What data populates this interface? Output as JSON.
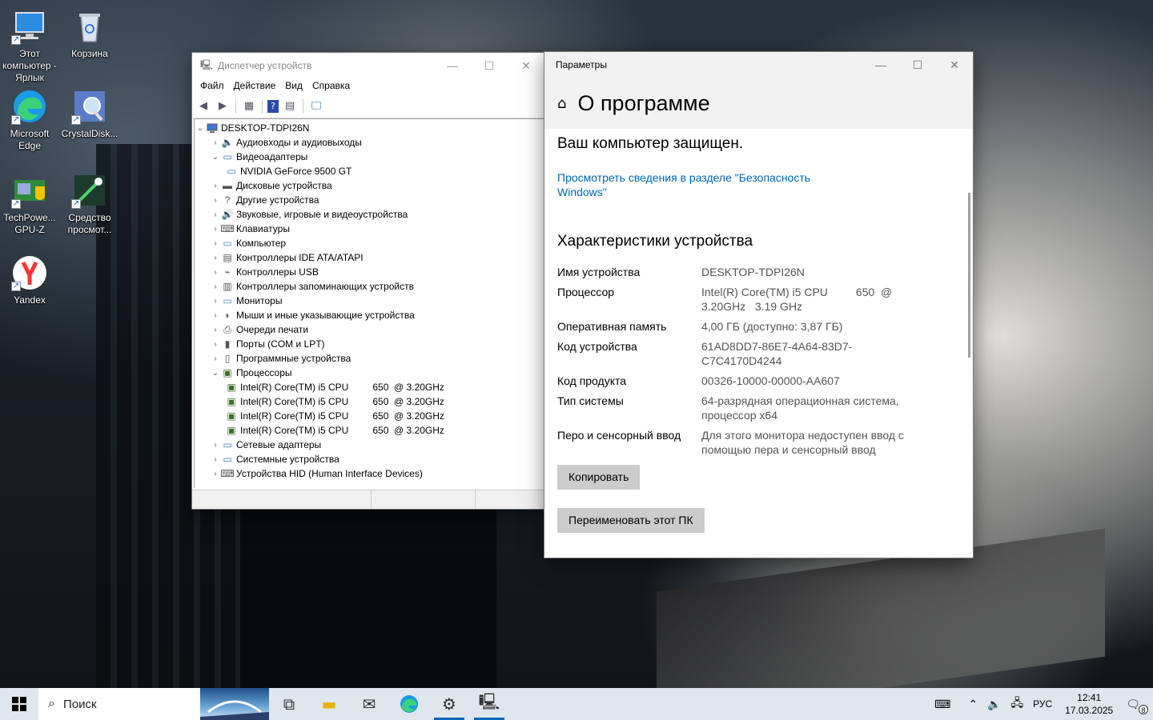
{
  "desktop": {
    "icons": [
      {
        "label": "Этот компьютер - Ярлык",
        "icon": "computer-icon"
      },
      {
        "label": "Корзина",
        "icon": "recycle-bin-icon"
      },
      {
        "label": "Microsoft Edge",
        "icon": "edge-icon"
      },
      {
        "label": "CrystalDisk...",
        "icon": "crystaldisk-icon"
      },
      {
        "label": "TechPowe... GPU-Z",
        "icon": "gpu-z-icon"
      },
      {
        "label": "Средство просмот...",
        "icon": "viewer-tool-icon"
      },
      {
        "label": "Yandex",
        "icon": "yandex-icon"
      }
    ]
  },
  "device_manager": {
    "title": "Диспетчер устройств",
    "menu": [
      "Файл",
      "Действие",
      "Вид",
      "Справка"
    ],
    "root": "DESKTOP-TDPI26N",
    "items": [
      {
        "label": "Аудиовходы и аудиовыходы",
        "expanded": false,
        "icon": "audio-icon"
      },
      {
        "label": "Видеоадаптеры",
        "expanded": true,
        "icon": "display-adapter-icon"
      },
      {
        "label": "NVIDIA GeForce 9500 GT",
        "child": true,
        "icon": "display-adapter-icon"
      },
      {
        "label": "Дисковые устройства",
        "expanded": false,
        "icon": "disk-icon"
      },
      {
        "label": "Другие устройства",
        "expanded": false,
        "icon": "other-device-icon"
      },
      {
        "label": "Звуковые, игровые и видеоустройства",
        "expanded": false,
        "icon": "sound-icon"
      },
      {
        "label": "Клавиатуры",
        "expanded": false,
        "icon": "keyboard-icon"
      },
      {
        "label": "Компьютер",
        "expanded": false,
        "icon": "monitor-icon"
      },
      {
        "label": "Контроллеры IDE ATA/ATAPI",
        "expanded": false,
        "icon": "ide-icon"
      },
      {
        "label": "Контроллеры USB",
        "expanded": false,
        "icon": "usb-icon"
      },
      {
        "label": "Контроллеры запоминающих устройств",
        "expanded": false,
        "icon": "storage-icon"
      },
      {
        "label": "Мониторы",
        "expanded": false,
        "icon": "monitor-icon"
      },
      {
        "label": "Мыши и иные указывающие устройства",
        "expanded": false,
        "icon": "mouse-icon"
      },
      {
        "label": "Очереди печати",
        "expanded": false,
        "icon": "printer-icon"
      },
      {
        "label": "Порты (COM и LPT)",
        "expanded": false,
        "icon": "port-icon"
      },
      {
        "label": "Программные устройства",
        "expanded": false,
        "icon": "software-device-icon"
      },
      {
        "label": "Процессоры",
        "expanded": true,
        "icon": "cpu-icon"
      },
      {
        "label": "Intel(R) Core(TM) i5 CPU         650  @ 3.20GHz",
        "child": true,
        "icon": "cpu-icon"
      },
      {
        "label": "Intel(R) Core(TM) i5 CPU         650  @ 3.20GHz",
        "child": true,
        "icon": "cpu-icon"
      },
      {
        "label": "Intel(R) Core(TM) i5 CPU         650  @ 3.20GHz",
        "child": true,
        "icon": "cpu-icon"
      },
      {
        "label": "Intel(R) Core(TM) i5 CPU         650  @ 3.20GHz",
        "child": true,
        "icon": "cpu-icon"
      },
      {
        "label": "Сетевые адаптеры",
        "expanded": false,
        "icon": "network-icon"
      },
      {
        "label": "Системные устройства",
        "expanded": false,
        "icon": "system-icon"
      },
      {
        "label": "Устройства HID (Human Interface Devices)",
        "expanded": false,
        "icon": "hid-icon"
      }
    ]
  },
  "settings": {
    "window_title": "Параметры",
    "page_title": "О программе",
    "protected": "Ваш компьютер защищен.",
    "security_link": "Просмотреть сведения в разделе \"Безопасность Windows\"",
    "specs_heading": "Характеристики устройства",
    "specs": [
      {
        "key": "Имя устройства",
        "value": "DESKTOP-TDPI26N"
      },
      {
        "key": "Процессор",
        "value": "Intel(R) Core(TM) i5 CPU         650  @ 3.20GHz   3.19 GHz"
      },
      {
        "key": "Оперативная память",
        "value": "4,00 ГБ (доступно: 3,87 ГБ)"
      },
      {
        "key": "Код устройства",
        "value": "61AD8DD7-86E7-4A64-83D7-C7C4170D4244"
      },
      {
        "key": "Код продукта",
        "value": "00326-10000-00000-AA607"
      },
      {
        "key": "Тип системы",
        "value": "64-разрядная операционная система, процессор x64"
      },
      {
        "key": "Перо и сенсорный ввод",
        "value": "Для этого монитора недоступен ввод с помощью пера и сенсорный ввод"
      }
    ],
    "copy_button": "Копировать",
    "rename_button": "Переименовать этот ПК"
  },
  "taskbar": {
    "search_placeholder": "Поиск",
    "language": "РУС",
    "time": "12:41",
    "date": "17.03.2025",
    "notifications_count": "8"
  },
  "colors": {
    "accent": "#0067b8",
    "taskbar": "#dfe6ee"
  }
}
